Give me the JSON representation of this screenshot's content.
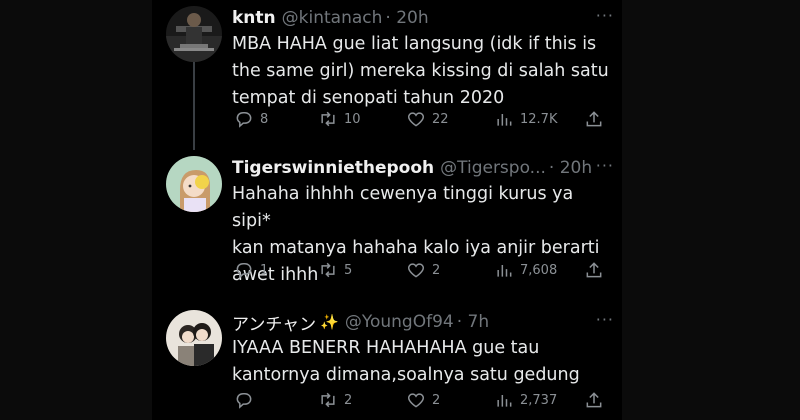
{
  "tweets": [
    {
      "name": "kntn",
      "handle": "@kintanach",
      "time": "· 20h",
      "more": "···",
      "text": "MBA HAHA gue liat langsung (idk if this is\nthe same girl) mereka kissing di salah satu\ntempat di senopati tahun 2020",
      "replies": "8",
      "retweets": "10",
      "likes": "22",
      "views": "12.7K"
    },
    {
      "name": "Tigerswinniethepooh",
      "handle": "@Tigerspo...",
      "time": "· 20h",
      "more": "···",
      "text": "Hahaha ihhhh cewenya tinggi kurus ya sipi*\nkan matanya hahaha kalo iya anjir berarti\nawet ihhh",
      "replies": "1",
      "retweets": "5",
      "likes": "2",
      "views": "7,608"
    },
    {
      "name": "アンチャン",
      "name_badge": "✨",
      "handle": "@YoungOf94",
      "time": "· 7h",
      "more": "···",
      "text": "IYAAA BENERR HAHAHAHA gue tau\nkantornya dimana,soalnya satu gedung",
      "replies": "",
      "retweets": "2",
      "likes": "2",
      "views": "2,737"
    }
  ],
  "icons": {
    "reply": "reply-icon",
    "retweet": "retweet-icon",
    "like": "heart-icon",
    "views": "views-icon",
    "share": "share-icon"
  },
  "colors": {
    "background": "#000000",
    "text": "#e7e9ea",
    "muted": "#71767b"
  }
}
